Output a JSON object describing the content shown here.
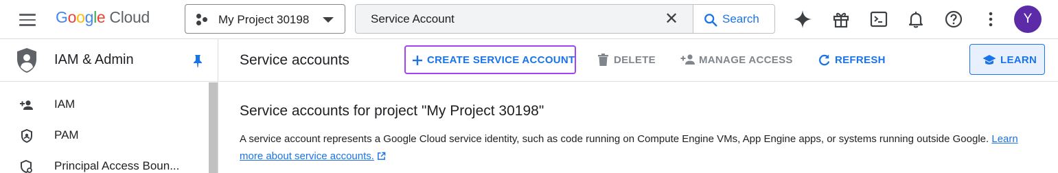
{
  "header": {
    "logo_google": [
      "G",
      "o",
      "o",
      "g",
      "l",
      "e"
    ],
    "logo_product": "Cloud",
    "project_name": "My Project 30198",
    "search": {
      "value": "Service Account",
      "button_label": "Search"
    },
    "avatar_initial": "Y",
    "icons": [
      "menu-icon",
      "gemini-sparkle-icon",
      "gift-icon",
      "cloud-shell-icon",
      "notifications-icon",
      "help-icon",
      "more-vert-icon"
    ]
  },
  "sidebar": {
    "title": "IAM & Admin",
    "items": [
      {
        "label": "IAM",
        "icon": "person-add-icon"
      },
      {
        "label": "PAM",
        "icon": "shield-icon"
      },
      {
        "label": "Principal Access Boun...",
        "icon": "policy-shield-icon"
      }
    ]
  },
  "main": {
    "page_title": "Service accounts",
    "actions": {
      "create": "CREATE SERVICE ACCOUNT",
      "delete": "DELETE",
      "manage": "MANAGE ACCESS",
      "refresh": "REFRESH",
      "learn": "LEARN"
    },
    "section_title": "Service accounts for project \"My Project 30198\"",
    "description": "A service account represents a Google Cloud service identity, such as code running on Compute Engine VMs, App Engine apps, or systems running outside Google.",
    "learn_more_link": "Learn more about service accounts."
  },
  "colors": {
    "accent": "#1a73e8",
    "focus_outline": "#a142f4",
    "avatar": "#5b2ba8",
    "disabled": "#80868b"
  }
}
